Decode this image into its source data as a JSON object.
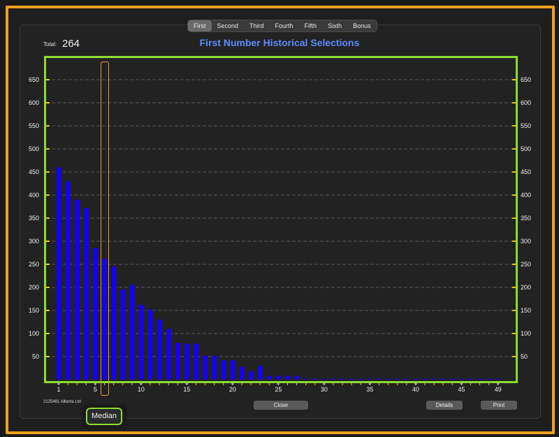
{
  "tabs": [
    "First",
    "Second",
    "Third",
    "Fourth",
    "Fifth",
    "Sixth",
    "Bonus"
  ],
  "active_tab": "First",
  "total_label": "Total:",
  "total_value": "264",
  "credit": "2125481 Alberta Ltd",
  "buttons": {
    "close": "Close",
    "details": "Details",
    "print": "Print"
  },
  "median_label": "Median",
  "median_value": 6,
  "colors": {
    "bar": "#1400ff",
    "frame": "#8cdc30",
    "title": "#5b8cff",
    "highlight": "#f0a020"
  },
  "chart_data": {
    "type": "bar",
    "title": "First Number Historical Selections",
    "xlabel": "",
    "ylabel": "",
    "x_ticks": [
      1,
      5,
      10,
      15,
      20,
      25,
      30,
      35,
      40,
      45,
      49
    ],
    "y_ticks": [
      50,
      100,
      150,
      200,
      250,
      300,
      350,
      400,
      450,
      500,
      550,
      600,
      650
    ],
    "ylim": [
      0,
      650
    ],
    "xlim": [
      1,
      49
    ],
    "grid": true,
    "categories": [
      1,
      2,
      3,
      4,
      5,
      6,
      7,
      8,
      9,
      10,
      11,
      12,
      13,
      14,
      15,
      16,
      17,
      18,
      19,
      20,
      21,
      22,
      23,
      24,
      25,
      26,
      27,
      28,
      29,
      30,
      31,
      32,
      33,
      34,
      35,
      36,
      37,
      38,
      39,
      40,
      41,
      42,
      43,
      44,
      45,
      46,
      47,
      48,
      49
    ],
    "values": [
      460,
      430,
      390,
      372,
      285,
      262,
      245,
      195,
      205,
      162,
      152,
      130,
      110,
      80,
      78,
      78,
      52,
      52,
      42,
      42,
      28,
      18,
      30,
      8,
      8,
      8,
      8,
      2,
      2,
      2,
      2,
      2,
      2,
      2,
      2,
      2,
      2,
      2,
      2,
      2,
      2,
      2,
      2,
      2,
      2,
      2,
      2,
      2,
      2
    ]
  }
}
